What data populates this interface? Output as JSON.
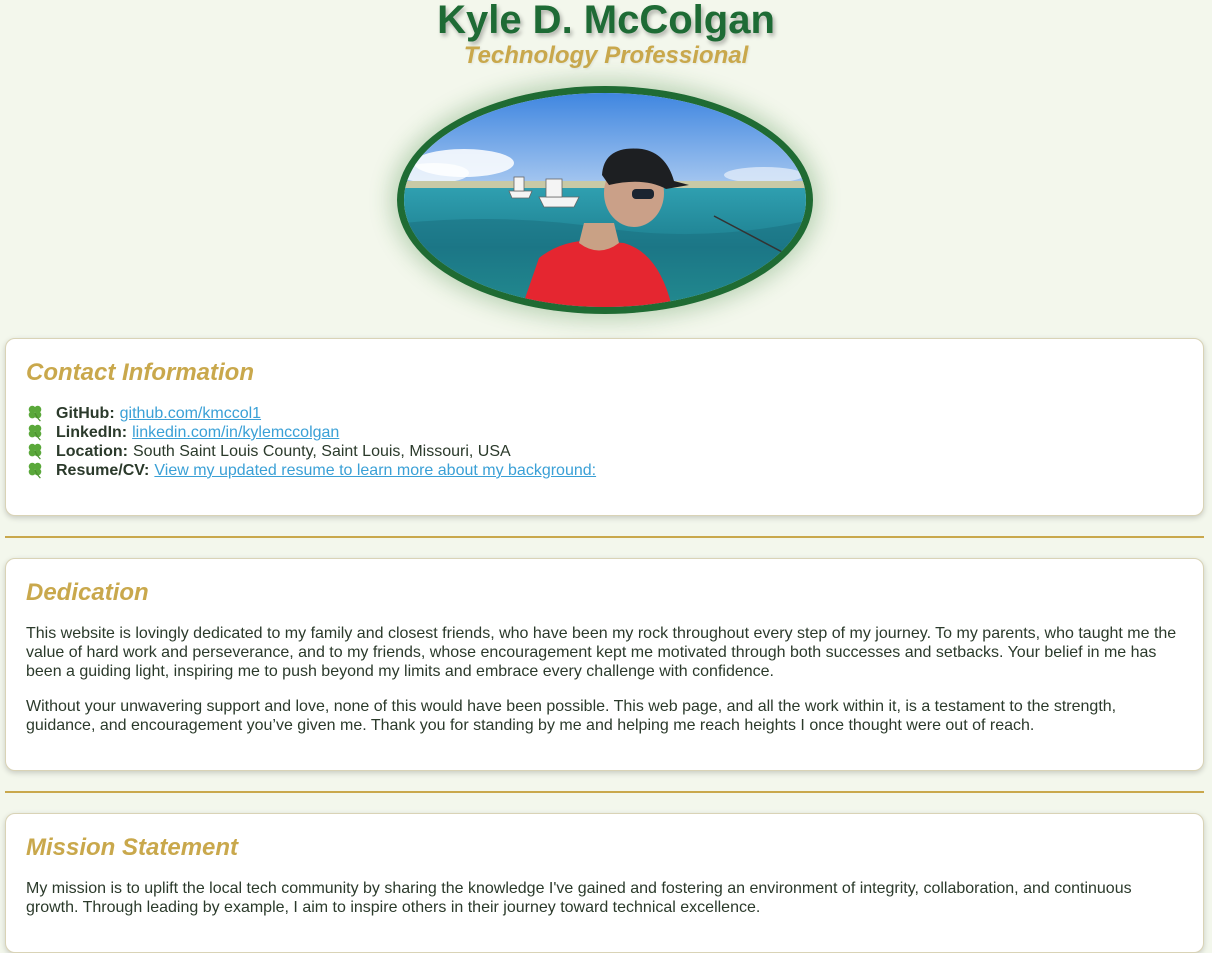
{
  "header": {
    "name": "Kyle D. McColgan",
    "title": "Technology Professional"
  },
  "portrait": {
    "subject": "profile-photo"
  },
  "contact": {
    "heading": "Contact Information",
    "items": [
      {
        "label": "GitHub:",
        "value": "github.com/kmccol1",
        "is_link": true
      },
      {
        "label": "LinkedIn:",
        "value": "linkedin.com/in/kylemccolgan",
        "is_link": true
      },
      {
        "label": "Location:",
        "value": "South Saint Louis County, Saint Louis, Missouri, USA",
        "is_link": false
      },
      {
        "label": "Resume/CV:",
        "value": "View my updated resume to learn more about my background:",
        "is_link": true
      }
    ],
    "bullet_icon": "four-leaf-clover-icon"
  },
  "dedication": {
    "heading": "Dedication",
    "paragraphs": [
      "This website is lovingly dedicated to my family and closest friends, who have been my rock throughout every step of my journey. To my parents, who taught me the value of hard work and perseverance, and to my friends, whose encouragement kept me motivated through both successes and setbacks. Your belief in me has been a guiding light, inspiring me to push beyond my limits and embrace every challenge with confidence.",
      "Without your unwavering support and love, none of this would have been possible. This web page, and all the work within it, is a testament to the strength, guidance, and encouragement you’ve given me. Thank you for standing by me and helping me reach heights I once thought were out of reach."
    ]
  },
  "mission": {
    "heading": "Mission Statement",
    "paragraphs": [
      "My mission is to uplift the local tech community by sharing the knowledge I've gained and fostering an environment of integrity, collaboration, and continuous growth. Through leading by example, I aim to inspire others in their journey toward technical excellence."
    ]
  },
  "colors": {
    "background": "#f3f7ec",
    "name_green": "#1e6b35",
    "accent_gold": "#c9a84c",
    "link_blue": "#3aa0d6"
  }
}
